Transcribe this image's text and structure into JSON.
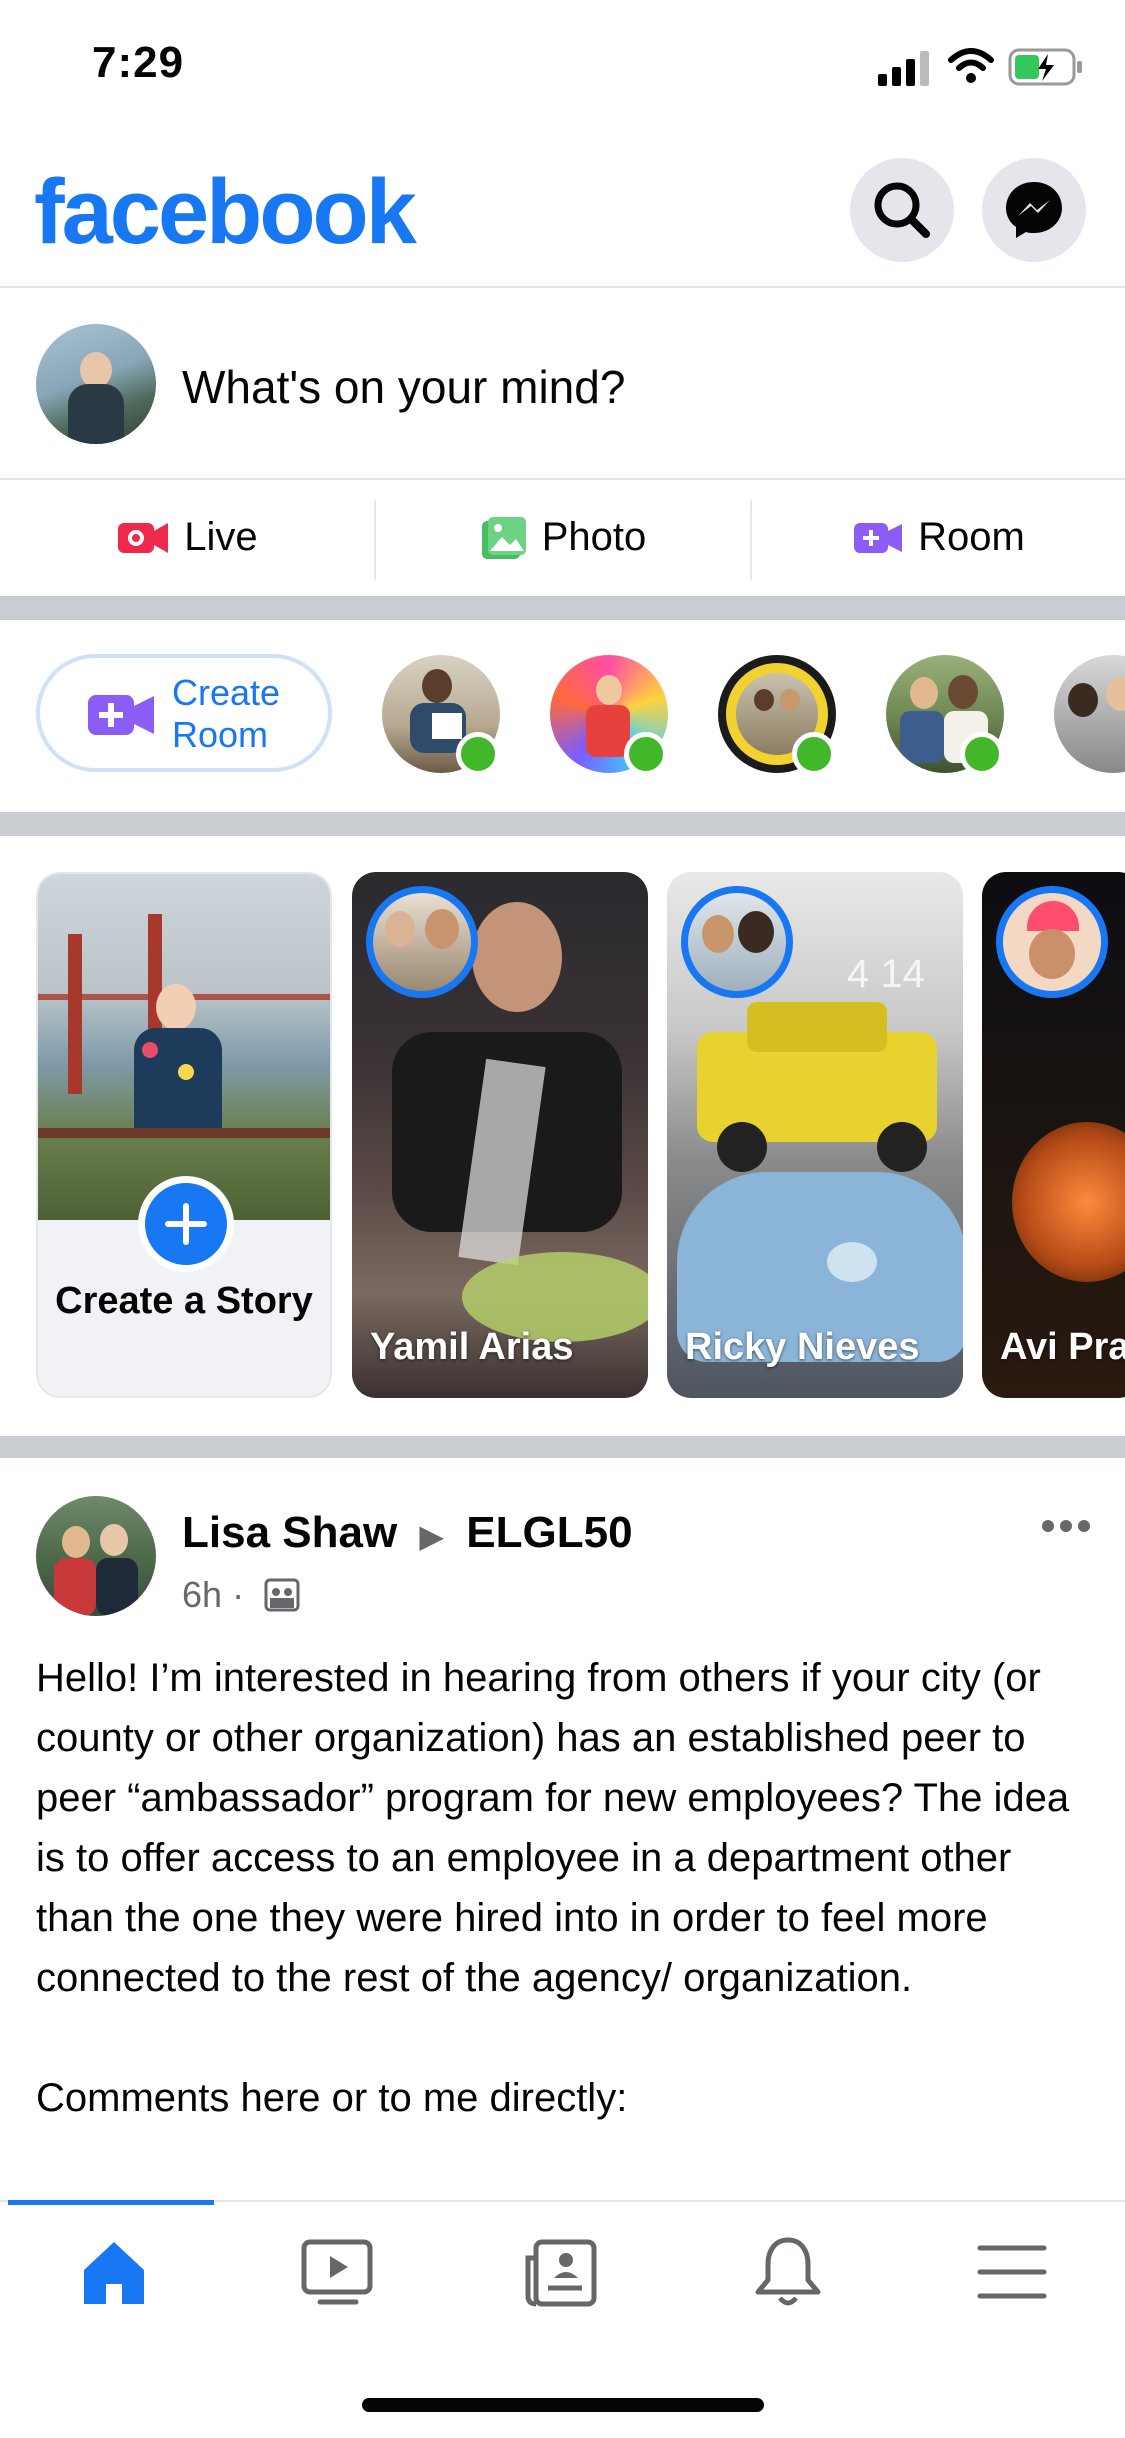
{
  "status_bar": {
    "time": "7:29"
  },
  "header": {
    "logo": "facebook",
    "search_icon": "search-icon",
    "messenger_icon": "messenger-icon"
  },
  "composer": {
    "placeholder": "What's on your mind?"
  },
  "actions": [
    {
      "label": "Live",
      "icon": "live-video-icon",
      "color": "#F02849"
    },
    {
      "label": "Photo",
      "icon": "photo-icon",
      "color": "#45BD62"
    },
    {
      "label": "Room",
      "icon": "room-video-icon",
      "color": "#8B5CF6"
    }
  ],
  "rooms": {
    "create_label": "Create Room"
  },
  "stories": [
    {
      "type": "create",
      "label": "Create a Story"
    },
    {
      "name": "Yamil Arias"
    },
    {
      "name": "Ricky Nieves"
    },
    {
      "name": "Avi Pra"
    }
  ],
  "post": {
    "author": "Lisa Shaw",
    "group": "ELGL50",
    "time": "6h",
    "body": "Hello! I’m interested in hearing from others if your city (or county or other organization) has an established peer to peer “ambassador” program for new employees? The idea is to offer access to an employee in a department other than the one they were hired into in order to feel more connected to the rest of the agency/ organization.",
    "body2": "Comments here or to me directly:"
  },
  "tabs": [
    "home-icon",
    "watch-icon",
    "news-icon",
    "notifications-icon",
    "menu-icon"
  ],
  "colors": {
    "brand": "#1877F2",
    "online": "#42b72a"
  }
}
